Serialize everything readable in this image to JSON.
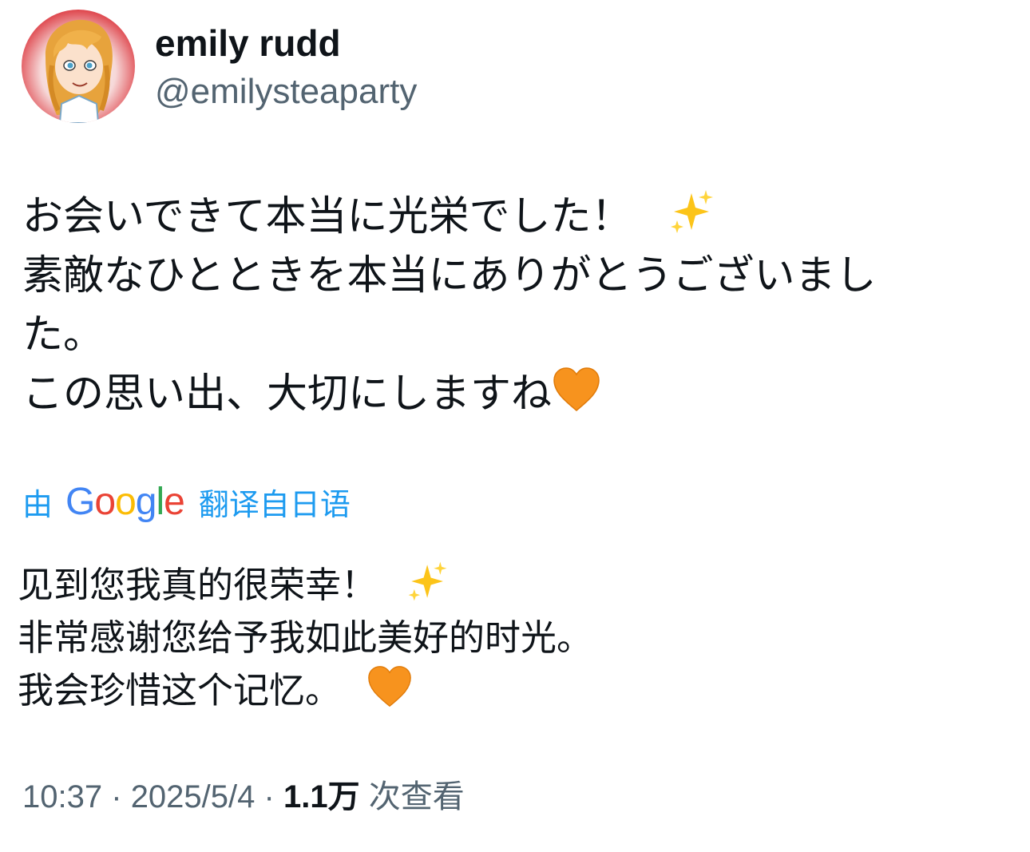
{
  "author": {
    "display_name": "emily rudd",
    "handle": "@emilysteaparty",
    "avatar_icon": "cartoon-portrait-avatar"
  },
  "tweet": {
    "lines": [
      "お会いできて本当に光栄でした！",
      "素敵なひとときを本当にありがとうございまし",
      "た。",
      "この思い出、大切にしますね"
    ],
    "emoji": {
      "sparkles": "sparkles-icon",
      "heart": "orange-heart-icon"
    }
  },
  "translation": {
    "by": "由",
    "provider": "Google",
    "from_label": "翻译自日语",
    "lines": [
      "见到您我真的很荣幸！",
      "非常感谢您给予我如此美好的时光。",
      "我会珍惜这个记忆。"
    ]
  },
  "meta": {
    "time": "10:37",
    "date": "2025/5/4",
    "views_count": "1.1万",
    "views_label": "次查看",
    "separator": "·"
  },
  "colors": {
    "text_primary": "#0f1419",
    "text_secondary": "#536471",
    "link_blue": "#1d9bf0",
    "heart_orange": "#f7931e",
    "google_blue": "#4285F4",
    "google_red": "#EA4335",
    "google_yellow": "#FBBC05",
    "google_green": "#34A853"
  }
}
